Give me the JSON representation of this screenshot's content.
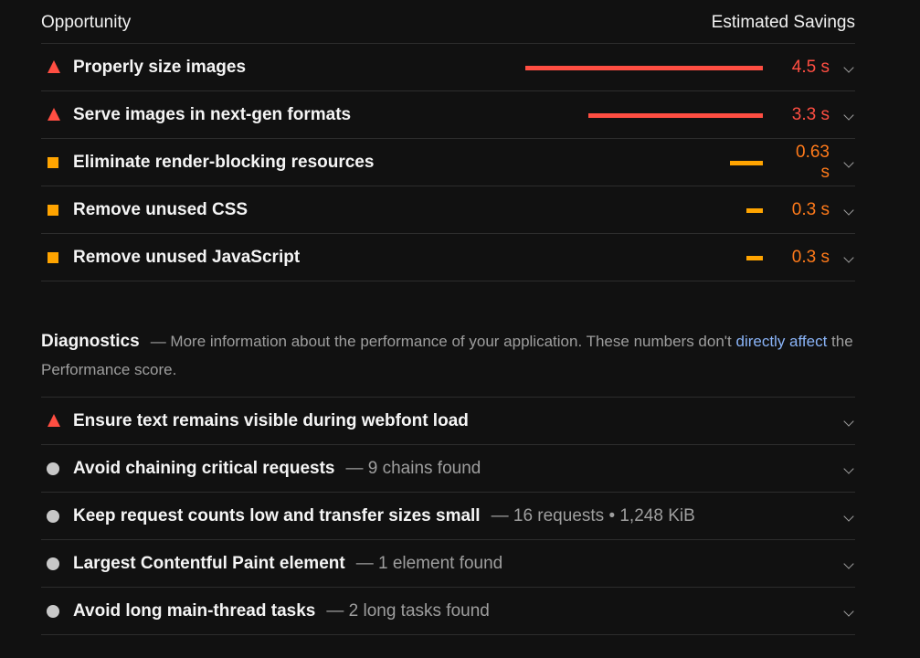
{
  "header": {
    "opportunity": "Opportunity",
    "estimated_savings": "Estimated Savings"
  },
  "opportunities": [
    {
      "title": "Properly size images",
      "severity": "fail",
      "icon": "triangle-warning-icon",
      "savings": "4.5 s",
      "savings_value_s": 4.5
    },
    {
      "title": "Serve images in next-gen formats",
      "severity": "fail",
      "icon": "triangle-warning-icon",
      "savings": "3.3 s",
      "savings_value_s": 3.3
    },
    {
      "title": "Eliminate render-blocking resources",
      "severity": "average",
      "icon": "square-icon",
      "savings": "0.63 s",
      "savings_value_s": 0.63
    },
    {
      "title": "Remove unused CSS",
      "severity": "average",
      "icon": "square-icon",
      "savings": "0.3 s",
      "savings_value_s": 0.3
    },
    {
      "title": "Remove unused JavaScript",
      "severity": "average",
      "icon": "square-icon",
      "savings": "0.3 s",
      "savings_value_s": 0.3
    }
  ],
  "diagnostics": {
    "title": "Diagnostics",
    "desc_prefix": "— More information about the performance of your application. These numbers don't ",
    "link_text": "directly affect",
    "desc_suffix": " the Performance score.",
    "items": [
      {
        "title": "Ensure text remains visible during webfont load",
        "severity": "fail",
        "icon": "triangle-warning-icon",
        "detail": ""
      },
      {
        "title": "Avoid chaining critical requests",
        "severity": "info",
        "icon": "circle-icon",
        "detail": "— 9 chains found"
      },
      {
        "title": "Keep request counts low and transfer sizes small",
        "severity": "info",
        "icon": "circle-icon",
        "detail": "— 16 requests • 1,248 KiB"
      },
      {
        "title": "Largest Contentful Paint element",
        "severity": "info",
        "icon": "circle-icon",
        "detail": "— 1 element found"
      },
      {
        "title": "Avoid long main-thread tasks",
        "severity": "info",
        "icon": "circle-icon",
        "detail": "— 2 long tasks found"
      }
    ]
  },
  "colors": {
    "fail": "#ff4e42",
    "average": "#ffa400",
    "average_text": "#ff7a1a",
    "info": "#c8c8c8",
    "link": "#8ab4f8"
  }
}
